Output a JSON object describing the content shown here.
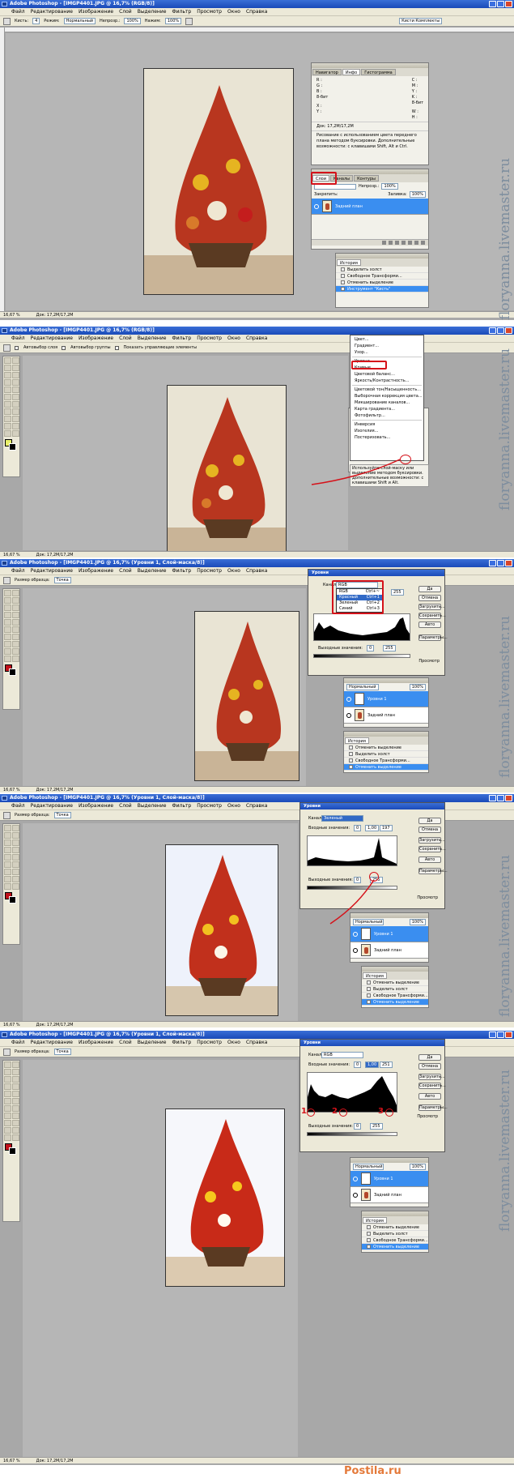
{
  "app": {
    "title_1": "Adobe Photoshop - [IMGP4401.JPG @ 16,7% (RGB/8)]",
    "title_2": "Adobe Photoshop - [IMGP4401.JPG @ 16,7% (RGB/8)]",
    "title_3": "Adobe Photoshop - [IMGP4401.JPG @ 16,7% (Уровни 1, Слой-маска/8)]",
    "title_4": "Adobe Photoshop - [IMGP4401.JPG @ 16,7% (Уровни 1, Слой-маска/8)]",
    "title_5": "Adobe Photoshop - [IMGP4401.JPG @ 16,7% (Уровни 1, Слой-маска/8)]"
  },
  "menu": [
    "Файл",
    "Редактирование",
    "Изображение",
    "Слой",
    "Выделение",
    "Фильтр",
    "Просмотр",
    "Окно",
    "Справка"
  ],
  "toolbar1": {
    "brush_label": "Кисть:",
    "brush_size": "4",
    "mode_label": "Режим:",
    "mode_value": "Нормальный",
    "opacity_label": "Непрозр.:",
    "opacity_value": "100%",
    "flow_label": "Нажим:",
    "flow_value": "100%",
    "workspace": "Кисти  Комплекты"
  },
  "toolbar2": {
    "auto_select": "Автовыбор слоя",
    "auto_select_group": "Автовыбор группы",
    "show_bounds": "Показать управляющие элементы"
  },
  "toolbar3": {
    "sample_label": "Размер образца:",
    "sample_value": "Точка"
  },
  "status": {
    "zoom": "16,67 %",
    "doc": "Док: 17,2M/17,2M"
  },
  "info_panel": {
    "tabs": [
      "Навигатор",
      "Инфо",
      "Гистограмма"
    ],
    "r": "R :",
    "g": "G :",
    "b": "B :",
    "c": "C :",
    "m": "M :",
    "y": "Y :",
    "k": "K :",
    "bits_left": "8-бит",
    "bits_right": "8-бит",
    "x": "X :",
    "y_coord": "Y :",
    "w": "W :",
    "h": "H :",
    "doc": "Док: 17,2M/17,2M",
    "hint": "Рисование с использованием цвета переднего плана методом буксировки. Дополнительные возможности: с клавишами Shift, Alt и Ctrl."
  },
  "layers_panel": {
    "tabs": [
      "Слои",
      "Каналы",
      "Контуры"
    ],
    "blend": "Нормальный",
    "opacity_label": "Непрозр.:",
    "opacity": "100%",
    "lock_label": "Закрепить:",
    "fill_label": "Заливка:",
    "fill": "100%",
    "layer_background": "Задний план",
    "layer_levels": "Уровни 1"
  },
  "history_panel": {
    "title": "История",
    "items": [
      "Выделить холст",
      "Свободное Трансформи...",
      "Отменить выделение",
      "Инструмент \"Кисть\""
    ],
    "items_short": [
      "Отменить выделение",
      "Выделить холст",
      "Свободное Трансформи...",
      "Отменить выделение"
    ]
  },
  "adj_menu": {
    "items": [
      "Цвет...",
      "Градиент...",
      "Узор...",
      "Уровни...",
      "Кривые...",
      "Цветовой баланс...",
      "Яркость/Контрастность...",
      "Цветовой тон/Насыщенность...",
      "Выборочная коррекция цвета...",
      "Микширование каналов...",
      "Карта градиента...",
      "Фотофильтр...",
      "Инверсия",
      "Изогелия...",
      "Постеризовать..."
    ],
    "hint": "Используйте слой-маску или выделение методом буксировки. Дополнительные возможности: с клавишами Shift и Alt."
  },
  "levels_dialog": {
    "title": "Уровни",
    "channel_label": "Канал:",
    "channel_rgb": "RGB",
    "channel_green": "Зеленый",
    "input_label": "Входные значения:",
    "output_label": "Выходные значения:",
    "in_black": "0",
    "in_gamma": "1,00",
    "in_white_3": "255",
    "in_white_4": "197",
    "in_white_5": "251",
    "out_black": "0",
    "out_white": "255",
    "buttons": [
      "Да",
      "Отмена",
      "Загрузить...",
      "Сохранить...",
      "Авто",
      "Параметры..."
    ],
    "preview": "Просмотр",
    "options": [
      {
        "name": "RGB",
        "key": "Ctrl+~"
      },
      {
        "name": "Красный",
        "key": "Ctrl+1"
      },
      {
        "name": "Зеленый",
        "key": "Ctrl+2"
      },
      {
        "name": "Синий",
        "key": "Ctrl+3"
      }
    ],
    "markers": [
      "1",
      "2",
      "3"
    ]
  },
  "watermark": "floryanna.livemaster.ru",
  "footer_logo": "Postila.ru",
  "colors": {
    "accent": "#d5121a",
    "selection": "#3a8ef0",
    "titlebar": "#1a4ab8"
  }
}
